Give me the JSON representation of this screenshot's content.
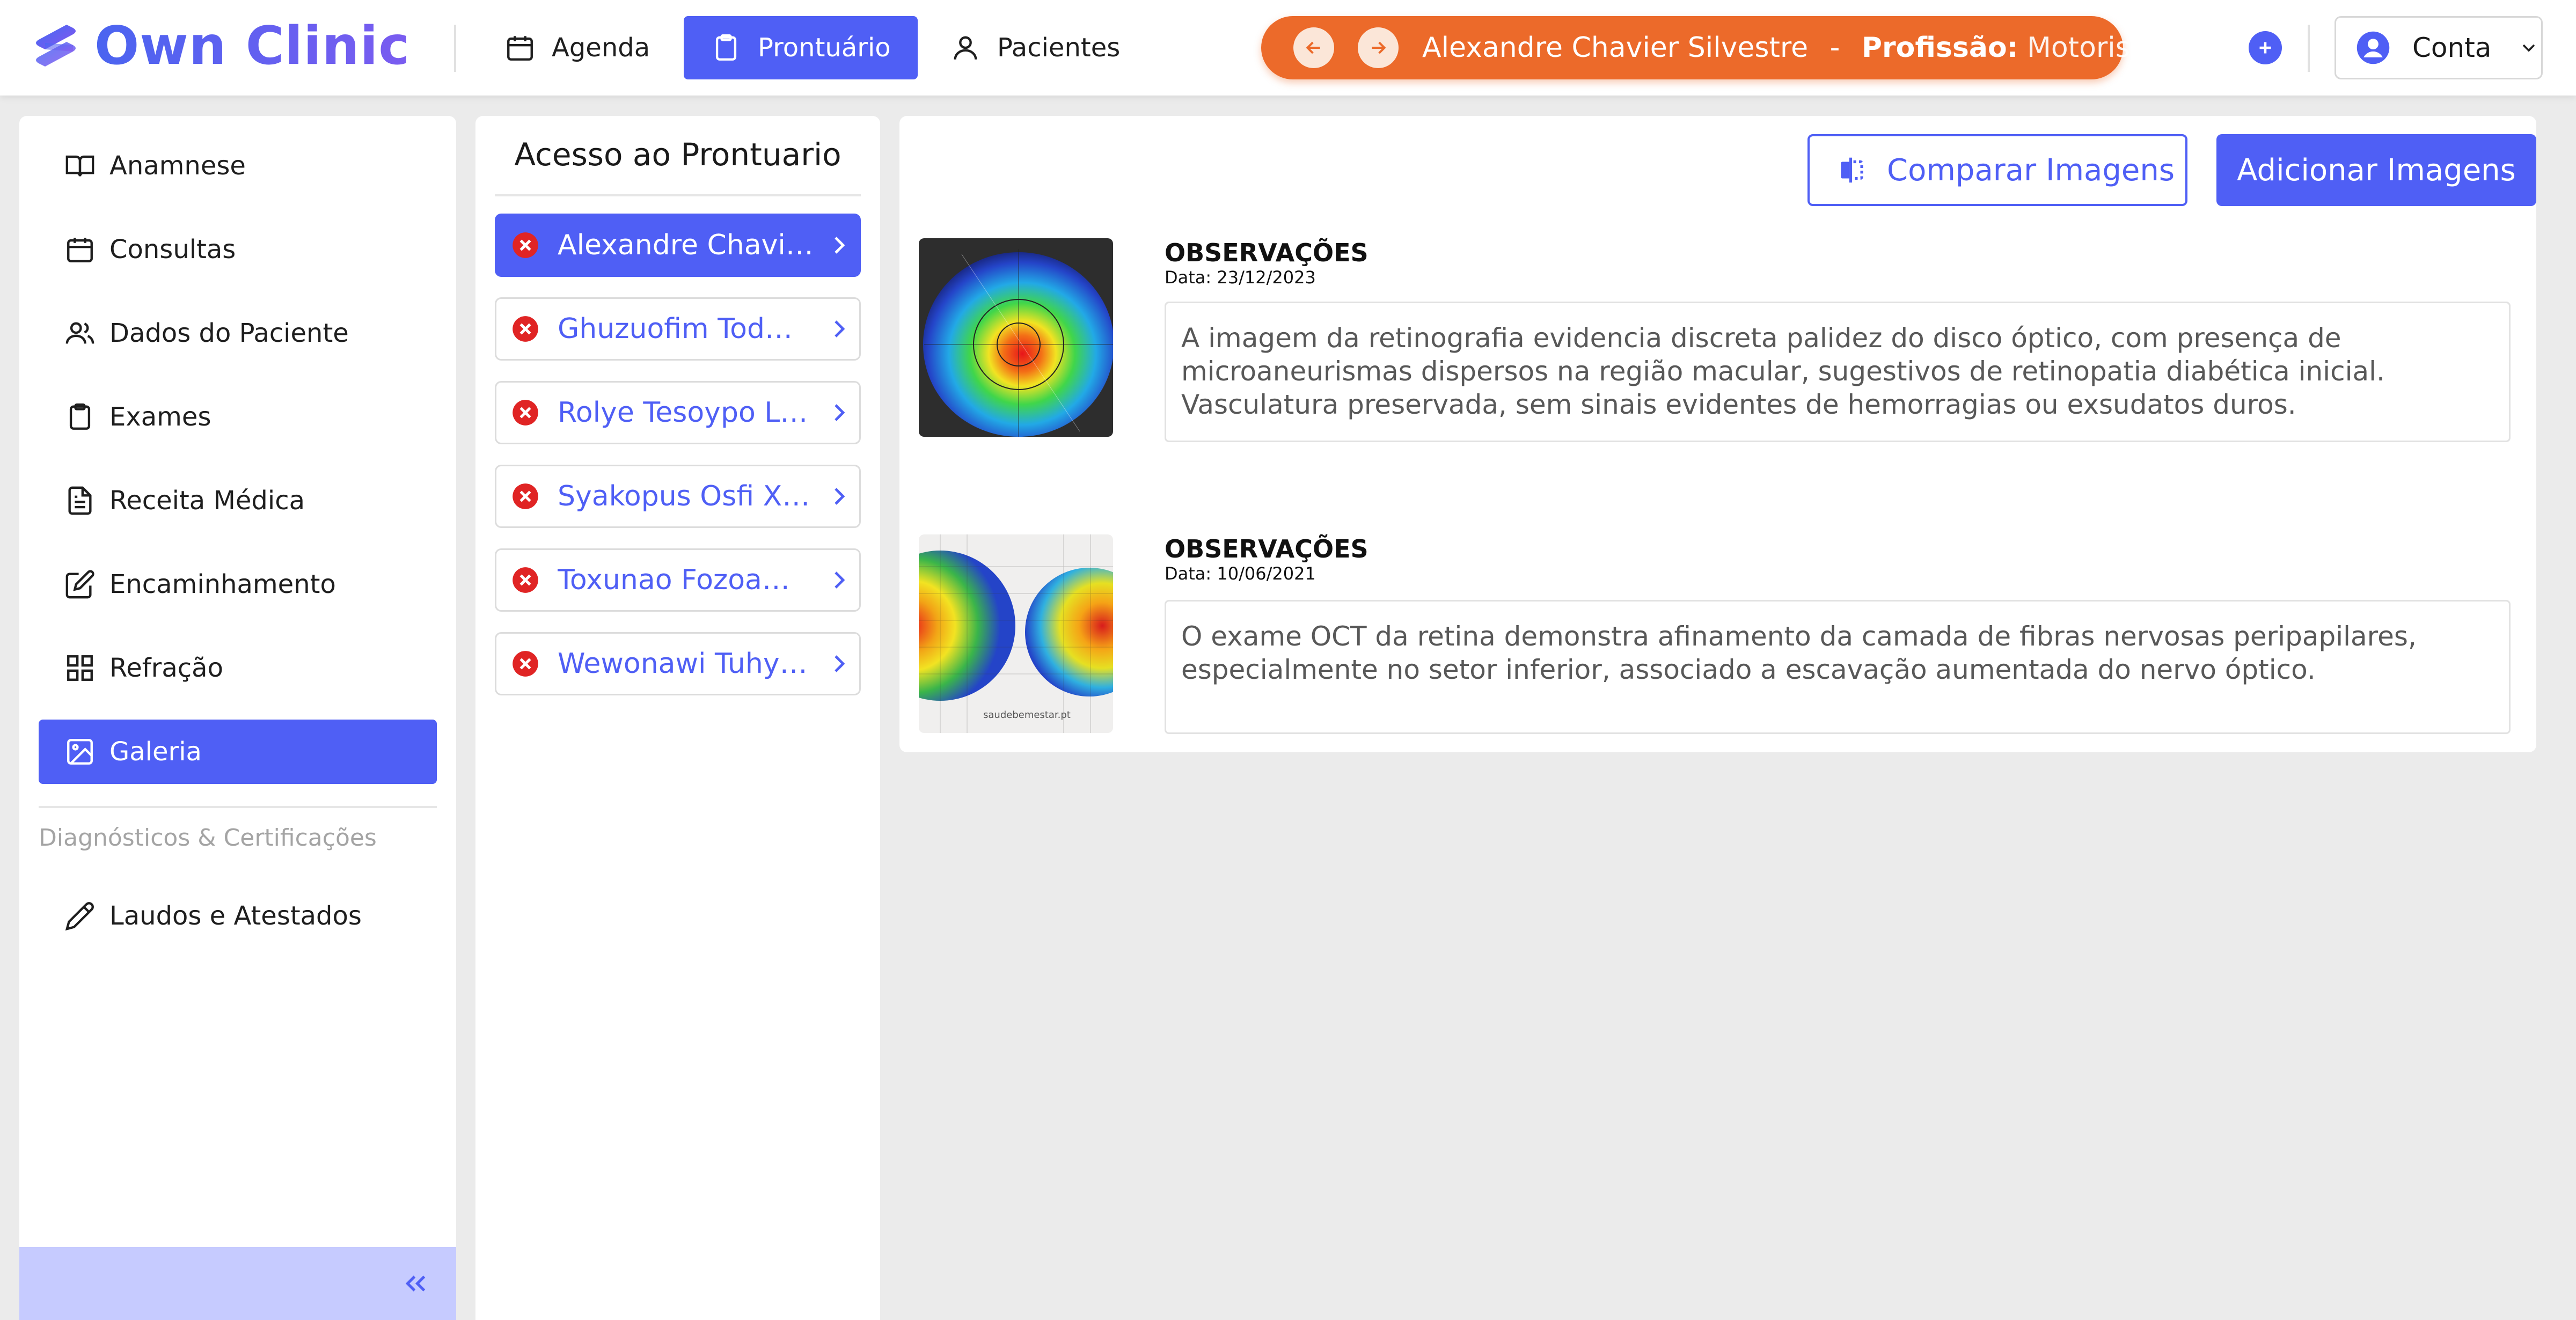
{
  "brand": {
    "name": "Own Clinic"
  },
  "topnav": {
    "items": [
      {
        "label": "Agenda",
        "icon": "calendar-icon",
        "active": false
      },
      {
        "label": "Prontuário",
        "icon": "clipboard-icon",
        "active": true
      },
      {
        "label": "Pacientes",
        "icon": "user-icon",
        "active": false
      }
    ]
  },
  "patient_bar": {
    "name": "Alexandre Chavier Silvestre",
    "separator": "-",
    "profession_label": "Profissão:",
    "profession_value": "Motorista"
  },
  "account": {
    "label": "Conta"
  },
  "sidebar": {
    "items": [
      {
        "label": "Anamnese",
        "icon": "book-open-icon"
      },
      {
        "label": "Consultas",
        "icon": "calendar-icon"
      },
      {
        "label": "Dados do Paciente",
        "icon": "users-icon"
      },
      {
        "label": "Exames",
        "icon": "clipboard-icon"
      },
      {
        "label": "Receita Médica",
        "icon": "file-text-icon"
      },
      {
        "label": "Encaminhamento",
        "icon": "edit-icon"
      },
      {
        "label": "Refração",
        "icon": "grid-icon"
      },
      {
        "label": "Galeria",
        "icon": "image-icon",
        "active": true
      }
    ],
    "section_label": "Diagnósticos & Certificações",
    "section_items": [
      {
        "label": "Laudos e Atestados",
        "icon": "pen-icon"
      }
    ]
  },
  "access_panel": {
    "title": "Acesso ao Prontuario",
    "items": [
      {
        "label": "Alexandre Chavi…",
        "active": true
      },
      {
        "label": "Ghuzuofim Tod…"
      },
      {
        "label": "Rolye Tesoypo L…"
      },
      {
        "label": "Syakopus Osfi X…"
      },
      {
        "label": "Toxunao Fozoa…"
      },
      {
        "label": "Wewonawi Tuhy…"
      }
    ]
  },
  "gallery": {
    "compare_label": "Comparar Imagens",
    "add_label": "Adicionar Imagens",
    "entries": [
      {
        "title": "OBSERVAÇÕES",
        "date": "Data: 23/12/2023",
        "text": "A imagem da retinografia evidencia discreta palidez do disco óptico, com presença de microaneurismas dispersos na região macular, sugestivos de retinopatia diabética inicial. Vasculatura preservada, sem sinais evidentes de hemorragias ou exsudatos duros."
      },
      {
        "title": "OBSERVAÇÕES",
        "date": "Data: 10/06/2021",
        "text": "O exame OCT da retina demonstra afinamento da camada de fibras nervosas peripapilares, especialmente no setor inferior, associado a escavação aumentada do nervo óptico.",
        "image_caption": "saudebemestar.pt"
      }
    ]
  },
  "colors": {
    "accent": "#4f5ff5",
    "patient_bar": "#ec6a2a",
    "danger": "#e02424",
    "collapse_bg": "#c6cbff"
  }
}
